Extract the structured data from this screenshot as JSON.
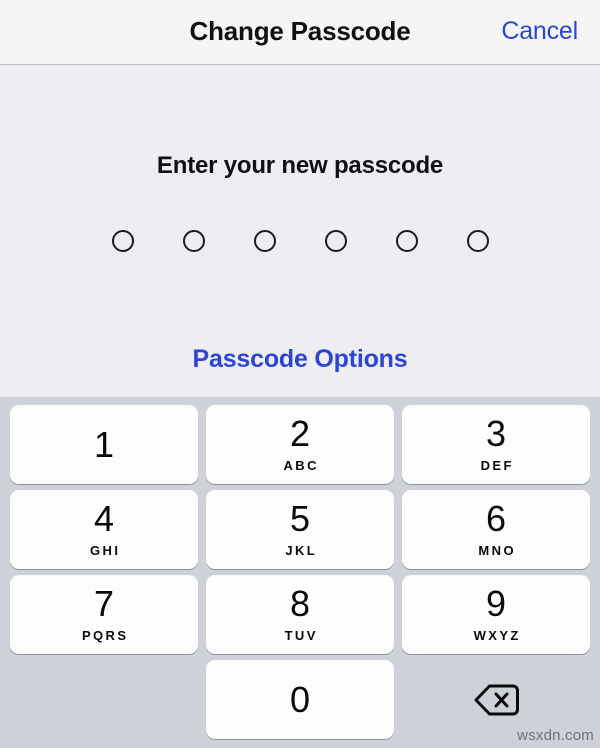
{
  "navbar": {
    "title": "Change Passcode",
    "cancel_label": "Cancel",
    "title_color": "#111114",
    "accent_color": "#2b45d4",
    "background": "#f5f5f5"
  },
  "prompt": {
    "text": "Enter your new passcode",
    "passcode_length": 6,
    "filled_count": 0,
    "options_label": "Passcode Options",
    "options_color": "#2b45d4",
    "background": "#eeeef2"
  },
  "keypad": {
    "background": "#cfd1d8",
    "key_background": "#fdfdfd",
    "keys": [
      {
        "digit": "1",
        "letters": ""
      },
      {
        "digit": "2",
        "letters": "ABC"
      },
      {
        "digit": "3",
        "letters": "DEF"
      },
      {
        "digit": "4",
        "letters": "GHI"
      },
      {
        "digit": "5",
        "letters": "JKL"
      },
      {
        "digit": "6",
        "letters": "MNO"
      },
      {
        "digit": "7",
        "letters": "PQRS"
      },
      {
        "digit": "8",
        "letters": "TUV"
      },
      {
        "digit": "9",
        "letters": "WXYZ"
      },
      {
        "digit": "0",
        "letters": ""
      }
    ],
    "delete_icon": "backspace-delete-icon"
  },
  "watermark": {
    "text": "wsxdn.com",
    "color": "#6e7076"
  }
}
